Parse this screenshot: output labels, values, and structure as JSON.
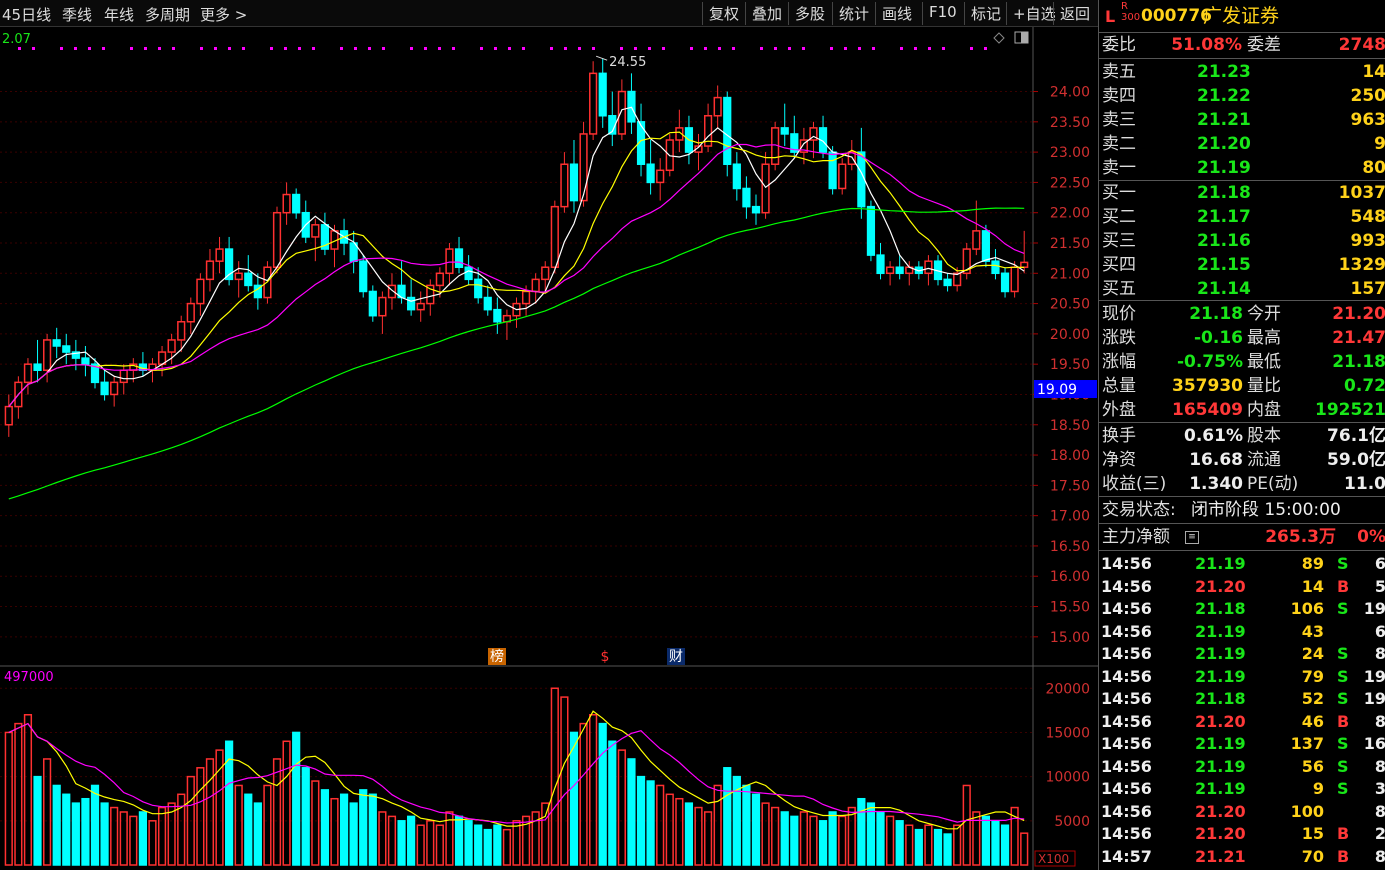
{
  "toolbar": {
    "left": [
      "45日线",
      "季线",
      "年线",
      "多周期",
      "更多 >"
    ],
    "right": [
      "复权",
      "叠加",
      "多股",
      "统计",
      "画线",
      "F10",
      "标记",
      "+自选",
      "返回"
    ]
  },
  "chart": {
    "ma_label": "2.07",
    "price_marker": "19.09",
    "high_label": "24.55",
    "volume_label": "497000",
    "volume_unit": "X100",
    "price_ticks": [
      "24.00",
      "23.50",
      "23.00",
      "22.50",
      "22.00",
      "21.50",
      "21.00",
      "20.50",
      "20.00",
      "19.50",
      "19.00",
      "18.50",
      "18.00",
      "17.50",
      "17.00",
      "16.50",
      "16.00",
      "15.50",
      "15.00"
    ],
    "volume_ticks": [
      "20000",
      "15000",
      "10000",
      "5000"
    ],
    "event_markers": [
      "榜",
      "$",
      "财"
    ]
  },
  "chart_data": {
    "type": "candlestick",
    "y_range": [
      14.7,
      24.9
    ],
    "volume_range": [
      0,
      21500
    ],
    "candles": [
      [
        18.5,
        19.0,
        18.3,
        18.8,
        1.5
      ],
      [
        18.8,
        19.3,
        18.6,
        19.2,
        1.6
      ],
      [
        19.2,
        19.6,
        19.0,
        19.5,
        1.7
      ],
      [
        19.5,
        19.9,
        19.2,
        19.4,
        1.0
      ],
      [
        19.4,
        20.0,
        19.2,
        19.9,
        1.2
      ],
      [
        19.9,
        20.1,
        19.6,
        19.8,
        0.9
      ],
      [
        19.8,
        20.0,
        19.5,
        19.7,
        0.8
      ],
      [
        19.7,
        19.9,
        19.4,
        19.6,
        0.7
      ],
      [
        19.6,
        19.8,
        19.3,
        19.5,
        0.75
      ],
      [
        19.5,
        19.6,
        19.1,
        19.2,
        0.9
      ],
      [
        19.2,
        19.4,
        18.9,
        19.0,
        0.7
      ],
      [
        19.0,
        19.3,
        18.8,
        19.2,
        0.65
      ],
      [
        19.2,
        19.5,
        19.0,
        19.4,
        0.6
      ],
      [
        19.4,
        19.6,
        19.2,
        19.5,
        0.55
      ],
      [
        19.5,
        19.7,
        19.3,
        19.4,
        0.6
      ],
      [
        19.4,
        19.6,
        19.2,
        19.5,
        0.5
      ],
      [
        19.5,
        19.8,
        19.3,
        19.7,
        0.65
      ],
      [
        19.7,
        20.0,
        19.5,
        19.9,
        0.7
      ],
      [
        19.9,
        20.3,
        19.7,
        20.2,
        0.8
      ],
      [
        20.2,
        20.6,
        20.0,
        20.5,
        1.0
      ],
      [
        20.5,
        21.0,
        20.3,
        20.9,
        1.1
      ],
      [
        20.9,
        21.4,
        20.7,
        21.2,
        1.2
      ],
      [
        21.2,
        21.6,
        21.0,
        21.4,
        1.3
      ],
      [
        21.4,
        21.6,
        20.8,
        20.9,
        1.4
      ],
      [
        20.9,
        21.2,
        20.6,
        21.0,
        0.9
      ],
      [
        21.0,
        21.3,
        20.7,
        20.8,
        0.8
      ],
      [
        20.8,
        21.0,
        20.4,
        20.6,
        0.7
      ],
      [
        20.6,
        21.2,
        20.5,
        21.1,
        0.9
      ],
      [
        21.1,
        22.1,
        21.0,
        22.0,
        1.2
      ],
      [
        22.0,
        22.5,
        21.8,
        22.3,
        1.4
      ],
      [
        22.3,
        22.4,
        21.9,
        22.0,
        1.5
      ],
      [
        22.0,
        22.2,
        21.5,
        21.6,
        1.1
      ],
      [
        21.6,
        21.9,
        21.2,
        21.8,
        0.95
      ],
      [
        21.8,
        22.0,
        21.3,
        21.4,
        0.85
      ],
      [
        21.4,
        21.8,
        21.1,
        21.7,
        0.75
      ],
      [
        21.7,
        21.9,
        21.3,
        21.5,
        0.8
      ],
      [
        21.5,
        21.7,
        21.0,
        21.2,
        0.7
      ],
      [
        21.2,
        21.3,
        20.6,
        20.7,
        0.85
      ],
      [
        20.7,
        20.8,
        20.2,
        20.3,
        0.8
      ],
      [
        20.3,
        20.7,
        20.0,
        20.6,
        0.6
      ],
      [
        20.6,
        21.0,
        20.4,
        20.8,
        0.55
      ],
      [
        20.8,
        21.2,
        20.5,
        20.6,
        0.5
      ],
      [
        20.6,
        20.9,
        20.3,
        20.4,
        0.55
      ],
      [
        20.4,
        20.7,
        20.2,
        20.5,
        0.45
      ],
      [
        20.5,
        20.9,
        20.3,
        20.8,
        0.5
      ],
      [
        20.8,
        21.1,
        20.6,
        21.0,
        0.45
      ],
      [
        21.0,
        21.5,
        20.8,
        21.4,
        0.6
      ],
      [
        21.4,
        21.6,
        21.0,
        21.1,
        0.55
      ],
      [
        21.1,
        21.3,
        20.8,
        20.9,
        0.5
      ],
      [
        20.9,
        21.1,
        20.5,
        20.6,
        0.45
      ],
      [
        20.6,
        20.8,
        20.3,
        20.4,
        0.4
      ],
      [
        20.4,
        20.6,
        20.0,
        20.2,
        0.45
      ],
      [
        20.2,
        20.4,
        19.9,
        20.3,
        0.4
      ],
      [
        20.3,
        20.6,
        20.1,
        20.5,
        0.5
      ],
      [
        20.5,
        20.8,
        20.3,
        20.7,
        0.55
      ],
      [
        20.7,
        21.0,
        20.5,
        20.9,
        0.6
      ],
      [
        20.9,
        21.2,
        20.7,
        21.1,
        0.7
      ],
      [
        21.1,
        22.2,
        21.0,
        22.1,
        2.0
      ],
      [
        22.1,
        23.0,
        22.0,
        22.8,
        1.9
      ],
      [
        22.8,
        23.2,
        22.0,
        22.2,
        1.5
      ],
      [
        22.2,
        23.5,
        22.1,
        23.3,
        1.6
      ],
      [
        23.3,
        24.5,
        23.2,
        24.3,
        1.7
      ],
      [
        24.3,
        24.55,
        23.4,
        23.6,
        1.6
      ],
      [
        23.6,
        24.0,
        23.1,
        23.3,
        1.4
      ],
      [
        23.3,
        24.2,
        23.2,
        24.0,
        1.3
      ],
      [
        24.0,
        24.3,
        23.3,
        23.5,
        1.2
      ],
      [
        23.5,
        23.8,
        22.6,
        22.8,
        1.0
      ],
      [
        22.8,
        23.2,
        22.3,
        22.5,
        0.95
      ],
      [
        22.5,
        22.9,
        22.2,
        22.7,
        0.9
      ],
      [
        22.7,
        23.3,
        22.6,
        23.2,
        0.8
      ],
      [
        23.2,
        23.7,
        23.0,
        23.4,
        0.75
      ],
      [
        23.4,
        23.6,
        22.8,
        23.0,
        0.7
      ],
      [
        23.0,
        23.3,
        22.7,
        23.1,
        0.65
      ],
      [
        23.1,
        23.8,
        23.0,
        23.6,
        0.6
      ],
      [
        23.6,
        24.1,
        23.4,
        23.9,
        0.9
      ],
      [
        23.9,
        24.0,
        22.6,
        22.8,
        1.1
      ],
      [
        22.8,
        23.0,
        22.2,
        22.4,
        1.0
      ],
      [
        22.4,
        22.6,
        21.9,
        22.1,
        0.9
      ],
      [
        22.1,
        22.3,
        21.8,
        22.0,
        0.8
      ],
      [
        22.0,
        23.0,
        21.9,
        22.8,
        0.7
      ],
      [
        22.8,
        23.5,
        22.7,
        23.4,
        0.65
      ],
      [
        23.4,
        23.8,
        23.1,
        23.3,
        0.6
      ],
      [
        23.3,
        23.6,
        22.9,
        23.0,
        0.55
      ],
      [
        23.0,
        23.4,
        22.8,
        23.2,
        0.6
      ],
      [
        23.2,
        23.5,
        22.9,
        23.4,
        0.55
      ],
      [
        23.4,
        23.6,
        22.9,
        23.0,
        0.5
      ],
      [
        23.0,
        23.1,
        22.3,
        22.4,
        0.6
      ],
      [
        22.4,
        22.9,
        22.3,
        22.8,
        0.55
      ],
      [
        22.8,
        23.2,
        22.7,
        23.0,
        0.65
      ],
      [
        23.0,
        23.4,
        21.9,
        22.1,
        0.75
      ],
      [
        22.1,
        22.2,
        21.2,
        21.3,
        0.7
      ],
      [
        21.3,
        21.5,
        20.9,
        21.0,
        0.6
      ],
      [
        21.0,
        21.2,
        20.8,
        21.1,
        0.55
      ],
      [
        21.1,
        21.3,
        20.9,
        21.0,
        0.5
      ],
      [
        21.0,
        21.2,
        20.8,
        21.1,
        0.45
      ],
      [
        21.1,
        21.2,
        20.9,
        21.0,
        0.4
      ],
      [
        21.0,
        21.3,
        20.8,
        21.2,
        0.45
      ],
      [
        21.2,
        21.3,
        20.8,
        20.9,
        0.4
      ],
      [
        20.9,
        21.0,
        20.7,
        20.8,
        0.35
      ],
      [
        20.8,
        21.1,
        20.7,
        21.0,
        0.45
      ],
      [
        21.0,
        21.5,
        20.9,
        21.4,
        0.9
      ],
      [
        21.4,
        22.2,
        21.3,
        21.7,
        0.6
      ],
      [
        21.7,
        21.8,
        21.1,
        21.2,
        0.55
      ],
      [
        21.2,
        21.4,
        20.9,
        21.0,
        0.5
      ],
      [
        21.0,
        21.1,
        20.6,
        20.7,
        0.45
      ],
      [
        20.7,
        21.2,
        20.6,
        21.1,
        0.65
      ],
      [
        21.1,
        21.7,
        21.0,
        21.18,
        0.36
      ]
    ]
  },
  "stock": {
    "prefix": "L",
    "code": "000776",
    "name": "广发证券",
    "wei_bi_label": "委比",
    "wei_bi": "51.08%",
    "wei_cha_label": "委差",
    "wei_cha": "2748",
    "asks": [
      {
        "label": "卖五",
        "price": "21.23",
        "vol": "14"
      },
      {
        "label": "卖四",
        "price": "21.22",
        "vol": "250"
      },
      {
        "label": "卖三",
        "price": "21.21",
        "vol": "963"
      },
      {
        "label": "卖二",
        "price": "21.20",
        "vol": "9"
      },
      {
        "label": "卖一",
        "price": "21.19",
        "vol": "80"
      }
    ],
    "bids": [
      {
        "label": "买一",
        "price": "21.18",
        "vol": "1037"
      },
      {
        "label": "买二",
        "price": "21.17",
        "vol": "548"
      },
      {
        "label": "买三",
        "price": "21.16",
        "vol": "993"
      },
      {
        "label": "买四",
        "price": "21.15",
        "vol": "1329"
      },
      {
        "label": "买五",
        "price": "21.14",
        "vol": "157"
      }
    ],
    "quote": [
      {
        "l1": "现价",
        "v1": "21.18",
        "c1": "g",
        "l2": "今开",
        "v2": "21.20",
        "c2": "r"
      },
      {
        "l1": "涨跌",
        "v1": "-0.16",
        "c1": "g",
        "l2": "最高",
        "v2": "21.47",
        "c2": "r"
      },
      {
        "l1": "涨幅",
        "v1": "-0.75%",
        "c1": "g",
        "l2": "最低",
        "v2": "21.18",
        "c2": "g"
      },
      {
        "l1": "总量",
        "v1": "357930",
        "c1": "y",
        "l2": "量比",
        "v2": "0.72",
        "c2": "g"
      },
      {
        "l1": "外盘",
        "v1": "165409",
        "c1": "r",
        "l2": "内盘",
        "v2": "192521",
        "c2": "g"
      }
    ],
    "fin": [
      {
        "l1": "换手",
        "v1": "0.61%",
        "l2": "股本",
        "v2": "76.1亿"
      },
      {
        "l1": "净资",
        "v1": "16.68",
        "l2": "流通",
        "v2": "59.0亿"
      },
      {
        "l1": "收益(三)",
        "v1": "1.340",
        "l2": "PE(动)",
        "v2": "11.0"
      }
    ],
    "status_label": "交易状态:",
    "status_value": "闭市阶段 15:00:00",
    "main_label": "主力净额",
    "main_value": "265.3万",
    "main_pct": "0%",
    "ticks": [
      {
        "t": "14:56",
        "p": "21.19",
        "v": "89",
        "bs": "S",
        "n": "6"
      },
      {
        "t": "14:56",
        "p": "21.20",
        "v": "14",
        "bs": "B",
        "n": "5"
      },
      {
        "t": "14:56",
        "p": "21.18",
        "v": "106",
        "bs": "S",
        "n": "19"
      },
      {
        "t": "14:56",
        "p": "21.19",
        "v": "43",
        "bs": "",
        "n": "6"
      },
      {
        "t": "14:56",
        "p": "21.19",
        "v": "24",
        "bs": "S",
        "n": "8"
      },
      {
        "t": "14:56",
        "p": "21.19",
        "v": "79",
        "bs": "S",
        "n": "19"
      },
      {
        "t": "14:56",
        "p": "21.18",
        "v": "52",
        "bs": "S",
        "n": "19"
      },
      {
        "t": "14:56",
        "p": "21.20",
        "v": "46",
        "bs": "B",
        "n": "8"
      },
      {
        "t": "14:56",
        "p": "21.19",
        "v": "137",
        "bs": "S",
        "n": "16"
      },
      {
        "t": "14:56",
        "p": "21.19",
        "v": "56",
        "bs": "S",
        "n": "8"
      },
      {
        "t": "14:56",
        "p": "21.19",
        "v": "9",
        "bs": "S",
        "n": "3"
      },
      {
        "t": "14:56",
        "p": "21.20",
        "v": "100",
        "bs": "",
        "n": "8"
      },
      {
        "t": "14:56",
        "p": "21.20",
        "v": "15",
        "bs": "B",
        "n": "2"
      },
      {
        "t": "14:57",
        "p": "21.21",
        "v": "70",
        "bs": "B",
        "n": "8"
      }
    ]
  },
  "colors": {
    "up": "#ff3030",
    "down": "#00ffff",
    "ma5": "#ffffff",
    "ma10": "#ffff00",
    "ma20": "#ff00ff",
    "ma60": "#00ff00",
    "volma5": "#ffff00",
    "volma10": "#ff00ff"
  }
}
